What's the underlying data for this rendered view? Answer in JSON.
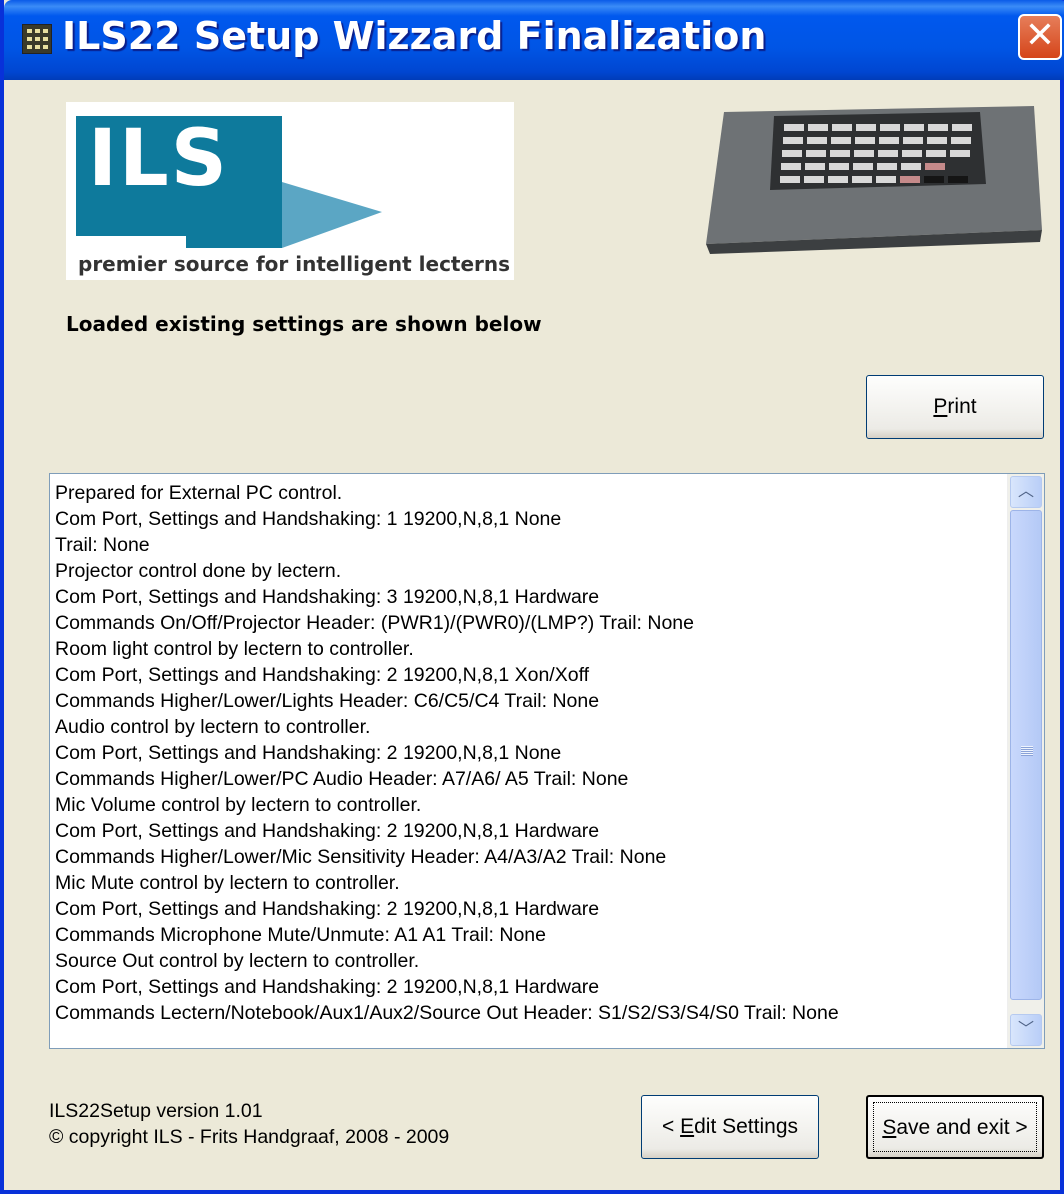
{
  "window": {
    "title": "ILS22 Setup Wizzard Finalization",
    "close_glyph": "✕"
  },
  "logo": {
    "wordmark": "ILS",
    "tagline": "premier source for intelligent lecterns"
  },
  "status_label": "Loaded existing settings are shown below",
  "buttons": {
    "print": {
      "mnemonic": "P",
      "rest": "rint"
    },
    "edit": {
      "prefix": "< ",
      "mnemonic": "E",
      "rest": "dit Settings"
    },
    "save": {
      "mnemonic": "S",
      "rest": "ave and exit >"
    }
  },
  "settings_lines": [
    "Prepared for External PC control.",
    "Com Port, Settings and Handshaking: 1 19200,N,8,1 None",
    "Trail: None",
    "Projector control done by lectern.",
    "Com Port, Settings and Handshaking: 3 19200,N,8,1 Hardware",
    "Commands On/Off/Projector Header: (PWR1)/(PWR0)/(LMP?) Trail: None",
    "Room light control by lectern to controller.",
    "Com Port, Settings and Handshaking: 2 19200,N,8,1 Xon/Xoff",
    "Commands Higher/Lower/Lights Header: C6/C5/C4 Trail: None",
    "Audio control by lectern to controller.",
    "Com Port, Settings and Handshaking: 2 19200,N,8,1 None",
    "Commands Higher/Lower/PC Audio Header: A7/A6/ A5 Trail: None",
    "Mic Volume control by lectern to controller.",
    "Com Port, Settings and Handshaking: 2 19200,N,8,1 Hardware",
    "Commands Higher/Lower/Mic Sensitivity Header: A4/A3/A2 Trail: None",
    "Mic Mute control by lectern to controller.",
    "Com Port, Settings and Handshaking: 2 19200,N,8,1 Hardware",
    "Commands Microphone Mute/Unmute: A1 A1 Trail: None",
    "Source Out control by lectern to controller.",
    "Com Port, Settings and Handshaking: 2 19200,N,8,1 Hardware",
    "Commands Lectern/Notebook/Aux1/Aux2/Source Out Header: S1/S2/S3/S4/S0 Trail: None"
  ],
  "footer": {
    "version": "ILS22Setup version 1.01",
    "copyright": "© copyright ILS - Frits Handgraaf, 2008 - 2009"
  },
  "scrollbar": {
    "up_glyph": "︿",
    "down_glyph": "﹀"
  }
}
